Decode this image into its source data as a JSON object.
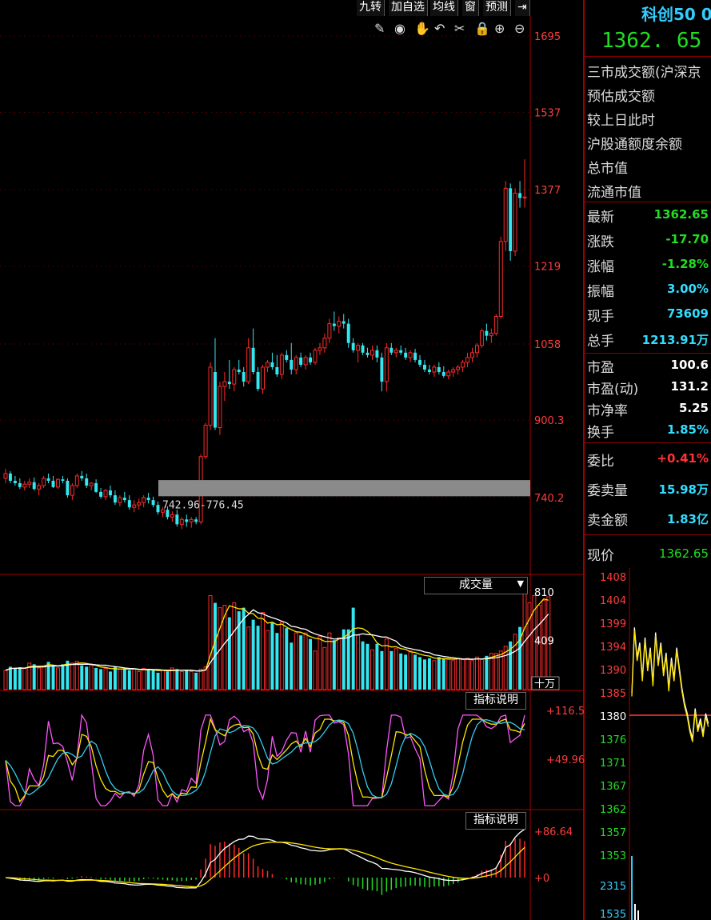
{
  "toolbar": {
    "buttons": [
      "九转",
      "加自选",
      "均线",
      "窗",
      "预测"
    ],
    "icons": [
      "pencil-icon",
      "eye-icon",
      "hand-icon",
      "undo-icon",
      "scissors-icon",
      "lock-icon",
      "zoom-in-icon",
      "zoom-out-icon"
    ]
  },
  "right_panel": {
    "title": "科创50 0",
    "price": "1362. 65",
    "info_rows": [
      "三市成交额(沪深京",
      "预估成交额",
      "较上日此时",
      "沪股通额度余额",
      "总市值",
      "流通市值"
    ],
    "quote_rows": [
      {
        "label": "最新",
        "value": "1362.65",
        "color": "#22dd22"
      },
      {
        "label": "涨跌",
        "value": "-17.70",
        "color": "#22dd22"
      },
      {
        "label": "涨幅",
        "value": "-1.28%",
        "color": "#22dd22"
      },
      {
        "label": "振幅",
        "value": "3.00%",
        "color": "#33ddff"
      },
      {
        "label": "现手",
        "value": "73609",
        "color": "#33ddff"
      },
      {
        "label": "总手",
        "value": "1213.91万",
        "color": "#33ddff"
      }
    ],
    "valuation_rows": [
      {
        "label": "市盈",
        "value": "100.6",
        "color": "#ffffff"
      },
      {
        "label": "市盈(动)",
        "value": "131.2",
        "color": "#ffffff"
      },
      {
        "label": "市净率",
        "value": "5.25",
        "color": "#ffffff"
      },
      {
        "label": "换手",
        "value": "1.85%",
        "color": "#33ddff"
      }
    ],
    "order_rows": [
      {
        "label": "委比",
        "value": "+0.41%",
        "color": "#ff3333"
      },
      {
        "label": "委卖量",
        "value": "15.98万",
        "color": "#33ddff"
      },
      {
        "label": "卖金额",
        "value": "1.83亿",
        "color": "#33ddff"
      }
    ],
    "current_price_label": "现价",
    "current_price_value": "1362.65"
  },
  "chart_data": [
    {
      "type": "candlestick",
      "panel": "main",
      "y_ticks": [
        "1695",
        "1537",
        "1377",
        "1219",
        "1058",
        "900.3",
        "740.2"
      ],
      "ylim": [
        740.2,
        1695
      ],
      "gap_annotation": "742.96-776.45",
      "gap_range": [
        742.96,
        776.45
      ],
      "candles": [
        [
          780,
          800,
          770,
          790
        ],
        [
          790,
          795,
          770,
          775
        ],
        [
          775,
          785,
          765,
          770
        ],
        [
          770,
          780,
          758,
          762
        ],
        [
          762,
          775,
          755,
          768
        ],
        [
          768,
          780,
          760,
          772
        ],
        [
          772,
          782,
          755,
          758
        ],
        [
          758,
          770,
          745,
          765
        ],
        [
          765,
          785,
          760,
          780
        ],
        [
          780,
          790,
          770,
          775
        ],
        [
          775,
          785,
          760,
          762
        ],
        [
          762,
          780,
          758,
          778
        ],
        [
          778,
          785,
          770,
          775
        ],
        [
          775,
          780,
          740,
          745
        ],
        [
          745,
          770,
          735,
          765
        ],
        [
          765,
          790,
          760,
          785
        ],
        [
          785,
          795,
          775,
          780
        ],
        [
          780,
          790,
          760,
          765
        ],
        [
          765,
          772,
          755,
          770
        ],
        [
          770,
          778,
          750,
          752
        ],
        [
          752,
          760,
          738,
          742
        ],
        [
          742,
          758,
          735,
          755
        ],
        [
          755,
          765,
          740,
          745
        ],
        [
          745,
          755,
          725,
          730
        ],
        [
          730,
          745,
          722,
          740
        ],
        [
          740,
          752,
          730,
          735
        ],
        [
          735,
          745,
          715,
          720
        ],
        [
          720,
          735,
          710,
          725
        ],
        [
          725,
          738,
          715,
          730
        ],
        [
          730,
          745,
          720,
          740
        ],
        [
          740,
          750,
          728,
          735
        ],
        [
          735,
          742,
          720,
          725
        ],
        [
          725,
          732,
          705,
          710
        ],
        [
          710,
          720,
          700,
          715
        ],
        [
          715,
          722,
          695,
          700
        ],
        [
          700,
          712,
          690,
          705
        ],
        [
          705,
          715,
          680,
          685
        ],
        [
          685,
          700,
          675,
          695
        ],
        [
          695,
          705,
          680,
          690
        ],
        [
          690,
          700,
          678,
          695
        ],
        [
          695,
          700,
          685,
          690
        ],
        [
          690,
          830,
          685,
          825
        ],
        [
          825,
          895,
          820,
          890
        ],
        [
          890,
          1020,
          880,
          1010
        ],
        [
          1000,
          1070,
          880,
          885
        ],
        [
          885,
          980,
          870,
          970
        ],
        [
          970,
          1000,
          940,
          980
        ],
        [
          980,
          1025,
          965,
          975
        ],
        [
          975,
          1010,
          960,
          1005
        ],
        [
          1005,
          1025,
          995,
          1000
        ],
        [
          1000,
          1010,
          970,
          980
        ],
        [
          980,
          1070,
          975,
          1050
        ],
        [
          1050,
          1090,
          995,
          1000
        ],
        [
          1000,
          1010,
          960,
          965
        ],
        [
          965,
          1015,
          955,
          1010
        ],
        [
          1010,
          1025,
          1000,
          1020
        ],
        [
          1020,
          1040,
          1005,
          1010
        ],
        [
          1010,
          1035,
          990,
          995
        ],
        [
          995,
          1040,
          985,
          1035
        ],
        [
          1035,
          1045,
          1020,
          1025
        ],
        [
          1025,
          1060,
          995,
          1005
        ],
        [
          1005,
          1035,
          995,
          1030
        ],
        [
          1030,
          1040,
          1010,
          1015
        ],
        [
          1015,
          1035,
          1005,
          1030
        ],
        [
          1030,
          1040,
          1015,
          1020
        ],
        [
          1020,
          1050,
          1015,
          1045
        ],
        [
          1045,
          1060,
          1035,
          1050
        ],
        [
          1050,
          1080,
          1040,
          1070
        ],
        [
          1070,
          1110,
          1060,
          1100
        ],
        [
          1100,
          1125,
          1085,
          1095
        ],
        [
          1095,
          1115,
          1080,
          1105
        ],
        [
          1105,
          1120,
          1090,
          1100
        ],
        [
          1100,
          1110,
          1050,
          1060
        ],
        [
          1060,
          1070,
          1040,
          1045
        ],
        [
          1045,
          1060,
          1020,
          1055
        ],
        [
          1055,
          1060,
          1035,
          1040
        ],
        [
          1040,
          1050,
          1030,
          1035
        ],
        [
          1035,
          1055,
          1025,
          1045
        ],
        [
          1045,
          1055,
          1020,
          1030
        ],
        [
          1030,
          1040,
          960,
          980
        ],
        [
          980,
          1060,
          960,
          1050
        ],
        [
          1050,
          1060,
          1035,
          1040
        ],
        [
          1040,
          1050,
          1030,
          1045
        ],
        [
          1045,
          1055,
          1035,
          1040
        ],
        [
          1040,
          1050,
          1025,
          1030
        ],
        [
          1030,
          1045,
          1020,
          1040
        ],
        [
          1040,
          1048,
          1020,
          1025
        ],
        [
          1025,
          1035,
          1010,
          1015
        ],
        [
          1015,
          1025,
          1000,
          1005
        ],
        [
          1005,
          1015,
          995,
          1000
        ],
        [
          1000,
          1015,
          990,
          1010
        ],
        [
          1010,
          1020,
          995,
          1000
        ],
        [
          1000,
          1012,
          988,
          992
        ],
        [
          992,
          1005,
          985,
          1000
        ],
        [
          1000,
          1010,
          990,
          1005
        ],
        [
          1005,
          1015,
          995,
          1010
        ],
        [
          1010,
          1025,
          1000,
          1020
        ],
        [
          1020,
          1040,
          1010,
          1030
        ],
        [
          1030,
          1050,
          1020,
          1040
        ],
        [
          1040,
          1060,
          1030,
          1055
        ],
        [
          1055,
          1090,
          1050,
          1085
        ],
        [
          1085,
          1100,
          1065,
          1075
        ],
        [
          1075,
          1090,
          1060,
          1080
        ],
        [
          1080,
          1120,
          1075,
          1115
        ],
        [
          1115,
          1280,
          1110,
          1270
        ],
        [
          1270,
          1395,
          1250,
          1380
        ],
        [
          1380,
          1390,
          1230,
          1250
        ],
        [
          1250,
          1380,
          1240,
          1370
        ],
        [
          1370,
          1395,
          1340,
          1360
        ],
        [
          1360,
          1440,
          1340,
          1362
        ]
      ]
    },
    {
      "type": "bar",
      "panel": "volume",
      "legend": "成交量",
      "y_ticks": [
        "810",
        "409"
      ],
      "ylim": [
        0,
        810
      ],
      "unit": "十万",
      "values": [
        160,
        190,
        180,
        185,
        175,
        220,
        210,
        180,
        195,
        230,
        200,
        180,
        210,
        240,
        220,
        235,
        200,
        190,
        200,
        180,
        170,
        175,
        150,
        190,
        170,
        175,
        160,
        170,
        150,
        175,
        165,
        160,
        140,
        160,
        150,
        180,
        170,
        150,
        160,
        150,
        140,
        170,
        190,
        780,
        720,
        680,
        700,
        600,
        720,
        650,
        680,
        520,
        580,
        530,
        640,
        490,
        560,
        470,
        560,
        510,
        390,
        470,
        450,
        470,
        420,
        320,
        440,
        350,
        470,
        410,
        430,
        500,
        500,
        680,
        450,
        400,
        380,
        330,
        380,
        320,
        420,
        320,
        340,
        300,
        290,
        320,
        290,
        270,
        250,
        260,
        240,
        270,
        260,
        250,
        240,
        260,
        250,
        260,
        240,
        270,
        250,
        280,
        300,
        300,
        320,
        360,
        400,
        460,
        520,
        820,
        720,
        780,
        700,
        740,
        770
      ]
    },
    {
      "type": "line",
      "panel": "indicator-1",
      "legend": "指标说明",
      "y_ticks": [
        "+116.5",
        "+49.96"
      ],
      "ylim": [
        10,
        125
      ]
    },
    {
      "type": "bar",
      "panel": "indicator-2",
      "legend": "指标说明",
      "y_ticks": [
        "+86.64",
        "+0"
      ],
      "ylim": [
        -25,
        95
      ]
    }
  ],
  "colors": {
    "up": "#ff2a2a",
    "down": "#33e6f0",
    "grid": "#7a0000",
    "axis_text": "#ff3c3c",
    "ma_white": "#ffffff",
    "ma_yellow": "#ffe600",
    "ma_magenta": "#ff55ff",
    "ma_cyan": "#33ccee"
  }
}
